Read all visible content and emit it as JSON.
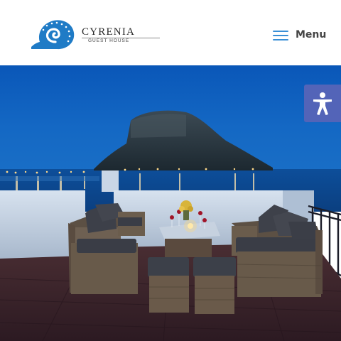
{
  "brand": {
    "name": "CYRENIA",
    "subtitle": "GUEST HOUSE",
    "accent_color": "#1f7bc6"
  },
  "header": {
    "menu_label": "Menu",
    "menu_icon": "hamburger-icon",
    "menu_icon_color": "#3a8fd6"
  },
  "hero": {
    "image_subject": "rooftop-terrace-night-sea-view"
  },
  "accessibility": {
    "icon": "accessibility-person-icon",
    "button_color": "#5364b8"
  }
}
